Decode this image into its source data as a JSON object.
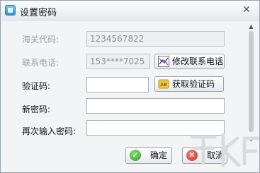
{
  "window": {
    "title": "设置密码",
    "close_glyph": "✕"
  },
  "form": {
    "customs_code": {
      "label": "海关代码:",
      "value": "1234567822"
    },
    "phone": {
      "label": "联系电话:",
      "value": "153****7025",
      "change_button": "修改联系电话"
    },
    "verify_code": {
      "label": "验证码:",
      "value": "",
      "get_button": "获取验证码"
    },
    "new_password": {
      "label": "新密码:",
      "value": ""
    },
    "confirm_password": {
      "label": "再次输入密码:",
      "value": ""
    }
  },
  "footer": {
    "ok_label": "确定",
    "cancel_label": "取消"
  },
  "icons": {
    "app": "app-icon",
    "phone": "chart-icon",
    "code": "ab-icon",
    "ok": "check-icon",
    "cancel": "x-icon"
  },
  "colors": {
    "accent": "#2e92cf",
    "ok": "#2f9a27",
    "cancel": "#c72b1e"
  }
}
